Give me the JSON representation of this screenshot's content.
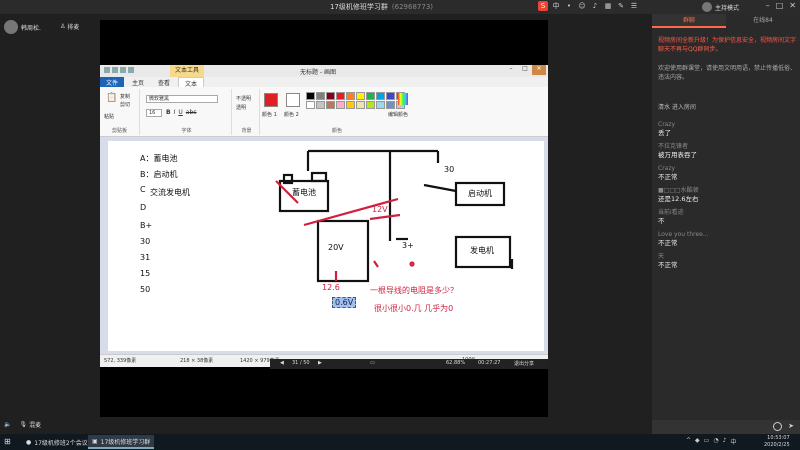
{
  "window": {
    "title": "17级机修班学习群",
    "subtitle": "(62968773)",
    "host_label": "主持模式"
  },
  "top_left": {
    "user_name": "韩周松.",
    "follow_label": "排麦"
  },
  "paint": {
    "context_tab": "文本工具",
    "doc_title": "无标题 - 画图",
    "tabs": [
      "文件",
      "主页",
      "查看",
      "文本"
    ],
    "groups": [
      "剪贴板",
      "字体",
      "背景",
      "颜色"
    ],
    "clipboard_items": [
      "复制",
      "剪切",
      "粘贴"
    ],
    "font_name": "微软雅黑",
    "font_size": "16",
    "format_buttons": [
      "B",
      "I",
      "U",
      "abc"
    ],
    "bg_options": [
      "不透明",
      "透明"
    ],
    "color1": "颜色 1",
    "color2": "颜色 2",
    "edit_colors": "编辑颜色",
    "status": {
      "cursor": "572, 339像素",
      "selection": "218 × 38像素",
      "size": "1420 × 979像素",
      "zoom": "100%"
    }
  },
  "canvas": {
    "legend": [
      "A：蓄电池",
      "B：启动机",
      "C",
      "交流发电机",
      "D",
      "B+",
      "30",
      "31",
      "15",
      "50"
    ],
    "labels": {
      "battery": "蓄电池",
      "starter": "启动机",
      "alternator": "发电机",
      "v20": "20V",
      "v12": "12V",
      "t30": "30",
      "t3plus": "3+",
      "v126": "12.6",
      "v06": "0.6V",
      "question": "一根导线的电阻是多少？",
      "answer": "很小很小0.几 几乎为0"
    }
  },
  "video_bar": {
    "page": "31 / 50",
    "zoom": "62.88%",
    "time": "00:27:27",
    "exit": "退出分享"
  },
  "right_panel": {
    "tabs": [
      "群聊",
      "在线84"
    ],
    "notice": "视频房间全新升级！为保护信息安全，视频房间文字聊天不再与QQ群同步。",
    "welcome": "欢迎使用群课堂，请使用文明用语，禁止传播低俗、违法内容。",
    "join": "清水 进入房间",
    "messages": [
      {
        "user": "Crazy",
        "text": "丢了"
      },
      {
        "user": "不拉克锋者",
        "text": "被万用表吞了"
      },
      {
        "user": "Crazy",
        "text": "不正常"
      },
      {
        "user": "■□□□水酷顿",
        "text": "还是12.6左右"
      },
      {
        "user": "当前i看迹",
        "text": "不"
      },
      {
        "user": "Love you three...",
        "text": "不正常"
      },
      {
        "user": "天",
        "text": "不正常"
      }
    ]
  },
  "bottom": {
    "mic_label": "混麦"
  },
  "taskbar": {
    "tasks": [
      "17级机修班2个会议",
      "17级机修班学习群"
    ],
    "time": "10:53:07",
    "date": "2020/2/25"
  },
  "colors": {
    "accent": "#ff6a4a",
    "drawing_red": "#d02040",
    "app_bg": "#202020"
  }
}
